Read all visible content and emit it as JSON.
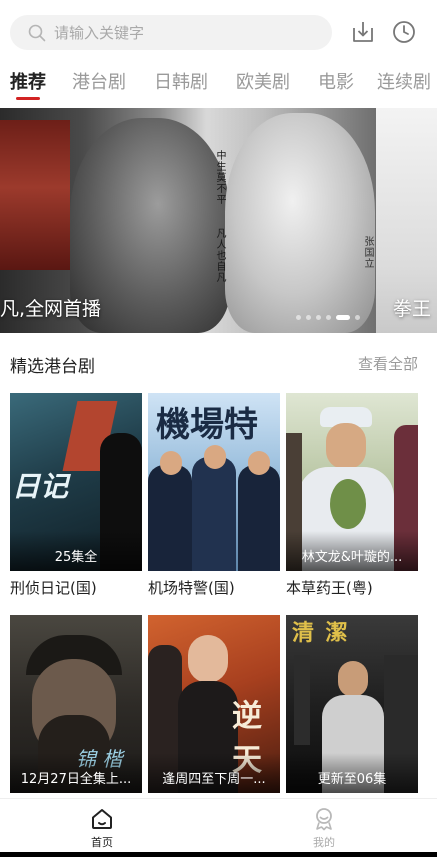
{
  "search": {
    "placeholder": "请输入关键字",
    "icon": "search-icon"
  },
  "top_actions": [
    {
      "icon": "download-icon"
    },
    {
      "icon": "history-clock-icon"
    }
  ],
  "tabs": [
    {
      "label": "推荐"
    },
    {
      "label": "港台剧"
    },
    {
      "label": "日韩剧"
    },
    {
      "label": "欧美剧"
    },
    {
      "label": "电影"
    },
    {
      "label": "连续剧"
    }
  ],
  "accent_color": "#d22323",
  "banner": {
    "caption": "凡,全网首播",
    "next_caption": "拳王",
    "poster_text_1": "中生莫不平",
    "poster_text_2": "凡人也自凡",
    "poster_text_3": "张国立",
    "active_slide": 5,
    "slide_count": 6
  },
  "section": {
    "title": "精选港台剧",
    "more": "查看全部"
  },
  "cards": [
    {
      "title": "刑侦日记(国)",
      "badge": "25集全",
      "poster_text": "日记"
    },
    {
      "title": "机场特警(国)",
      "badge": "",
      "poster_text": "機場特"
    },
    {
      "title": "本草药王(粤)",
      "badge": "林文龙&叶璇的...",
      "poster_text": ""
    },
    {
      "title": "",
      "badge": "12月27日全集上...",
      "poster_text": "锦 楷"
    },
    {
      "title": "",
      "badge": "逢周四至下周一...",
      "poster_text": "逆天"
    },
    {
      "title": "",
      "badge": "更新至06集",
      "poster_text": "清 潔"
    }
  ],
  "bottom_nav": [
    {
      "label": "首页",
      "icon": "home-icon",
      "active": true
    },
    {
      "label": "我的",
      "icon": "profile-icon",
      "active": false
    }
  ]
}
